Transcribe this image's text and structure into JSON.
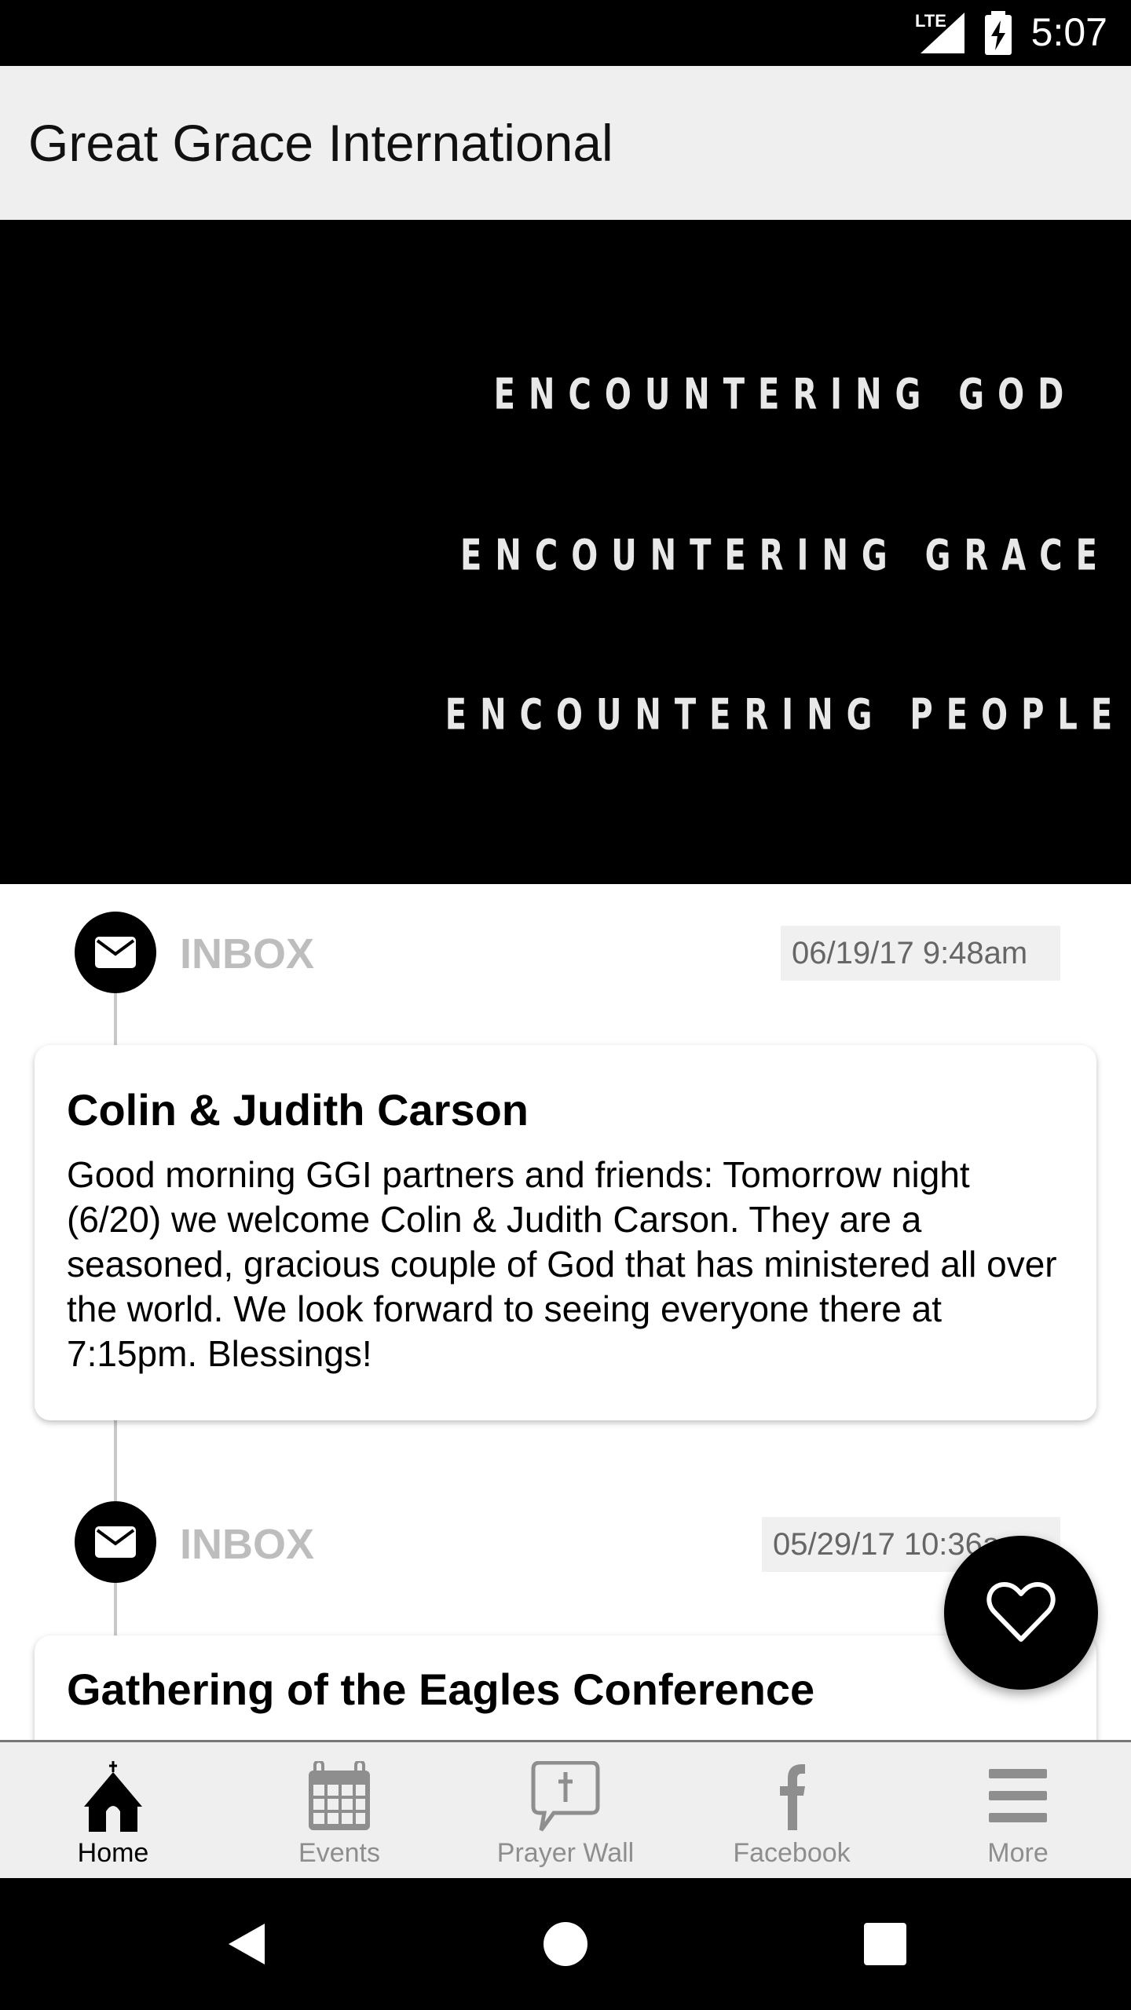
{
  "status_bar": {
    "network": "LTE",
    "time": "5:07"
  },
  "app_bar": {
    "title": "Great Grace International"
  },
  "banner": {
    "lines": [
      "ENCOUNTERING GOD",
      "ENCOUNTERING GRACE",
      "ENCOUNTERING PEOPLE"
    ]
  },
  "feed": [
    {
      "type": "INBOX",
      "timestamp": "06/19/17 9:48am",
      "title": "Colin & Judith Carson",
      "body": "Good morning GGI partners and friends: Tomorrow night (6/20) we welcome Colin & Judith Carson.  They are a seasoned, gracious couple of God that has ministered all over the world.  We look forward to seeing everyone there at 7:15pm.  Blessings!",
      "icon": "envelope-icon"
    },
    {
      "type": "INBOX",
      "timestamp": "05/29/17 10:36am",
      "title": "Gathering of the Eagles Conference",
      "icon": "envelope-icon"
    }
  ],
  "fab": {
    "icon": "heart-icon"
  },
  "tabs": [
    {
      "label": "Home",
      "icon": "church-icon",
      "active": true
    },
    {
      "label": "Events",
      "icon": "calendar-icon"
    },
    {
      "label": "Prayer Wall",
      "icon": "prayer-bubble-icon"
    },
    {
      "label": "Facebook",
      "icon": "facebook-icon"
    },
    {
      "label": "More",
      "icon": "menu-icon"
    }
  ]
}
